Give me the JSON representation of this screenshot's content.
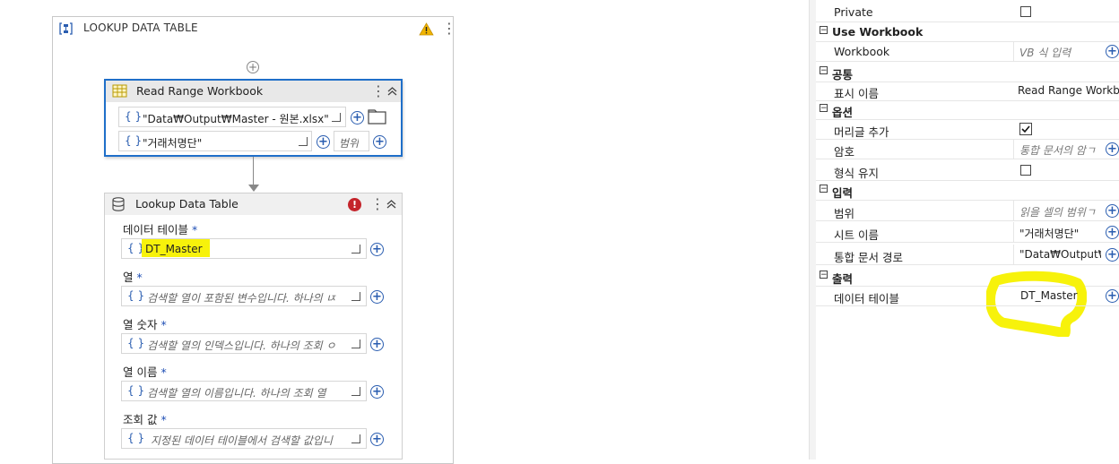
{
  "designer": {
    "sequence_title": "LOOKUP DATA TABLE",
    "read_range": {
      "title": "Read Range Workbook",
      "path_value": "\"Data₩Output₩Master - 원본.xlsx\"",
      "sheet_value": "\"거래처명단\"",
      "range_placeholder": "범위"
    },
    "lookup": {
      "title": "Lookup Data Table",
      "fields": [
        {
          "label": "데이터 테이블",
          "value": "DT_Master",
          "placeholder": ""
        },
        {
          "label": "열",
          "value": "",
          "placeholder": "검색할 열이 포함된 변수입니다. 하나의 ㄵ"
        },
        {
          "label": "열 숫자",
          "value": "",
          "placeholder": "검색할 열의 인덱스입니다. 하나의 조회 ㅇ"
        },
        {
          "label": "열 이름",
          "value": "",
          "placeholder": "검색할 열의 이름입니다. 하나의 조회 열"
        },
        {
          "label": "조회 값",
          "value": "",
          "placeholder": "지정된 데이터 테이블에서 검색할 값입니"
        }
      ],
      "required_mark": "*"
    }
  },
  "properties": {
    "private_label": "Private",
    "use_workbook": {
      "category": "Use Workbook",
      "workbook_label": "Workbook",
      "workbook_placeholder": "VB 식 입력"
    },
    "common": {
      "category": "공통",
      "display_name_label": "표시 이름",
      "display_name_value": "Read Range Workbo"
    },
    "options": {
      "category": "옵션",
      "add_headers_label": "머리글 추가",
      "password_label": "암호",
      "password_placeholder": "통합 문서의 암ㄱ",
      "preserve_format_label": "형식 유지"
    },
    "input": {
      "category": "입력",
      "range_label": "범위",
      "range_placeholder": "읽을 셀의 범위ㄱ",
      "sheet_label": "시트 이름",
      "sheet_value": "\"거래처명단\"",
      "path_label": "통합 문서 경로",
      "path_value": "\"Data₩Output₩"
    },
    "output": {
      "category": "출력",
      "datatable_label": "데이터 테이블",
      "datatable_value": "DT_Master"
    }
  },
  "colors": {
    "accent": "#1f6fc9",
    "highlight": "#f7f20b",
    "error": "#c4242b"
  }
}
